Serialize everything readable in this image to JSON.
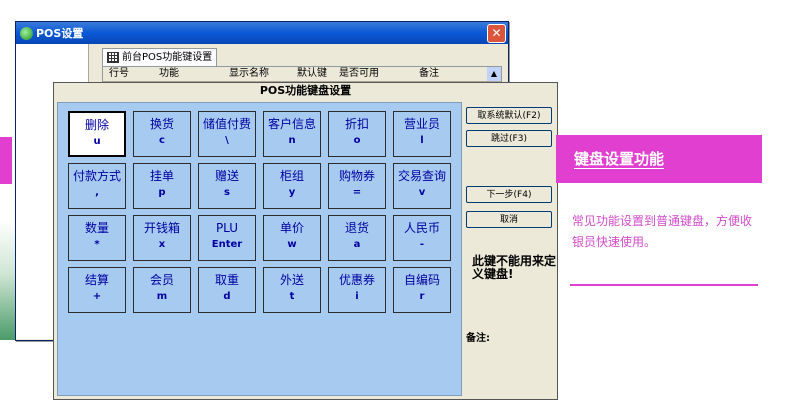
{
  "bg_window": {
    "title": "POS设置",
    "tab_label": "前台POS功能键设置",
    "column_headers": [
      "行号",
      "功能",
      "显示名称",
      "默认键",
      "是否可用",
      "备注"
    ]
  },
  "dialog": {
    "title": "POS功能键盘设置",
    "keys": [
      {
        "name": "删除",
        "code": "u"
      },
      {
        "name": "换货",
        "code": "c"
      },
      {
        "name": "储值付费",
        "code": "\\"
      },
      {
        "name": "客户信息",
        "code": "n"
      },
      {
        "name": "折扣",
        "code": "o"
      },
      {
        "name": "营业员",
        "code": "l"
      },
      {
        "name": "付款方式",
        "code": ","
      },
      {
        "name": "挂单",
        "code": "p"
      },
      {
        "name": "赠送",
        "code": "s"
      },
      {
        "name": "柜组",
        "code": "y"
      },
      {
        "name": "购物券",
        "code": "="
      },
      {
        "name": "交易查询",
        "code": "v"
      },
      {
        "name": "数量",
        "code": "*"
      },
      {
        "name": "开钱箱",
        "code": "x"
      },
      {
        "name": "PLU",
        "code": "Enter"
      },
      {
        "name": "单价",
        "code": "w"
      },
      {
        "name": "退货",
        "code": "a"
      },
      {
        "name": "人民币",
        "code": "-"
      },
      {
        "name": "结算",
        "code": "+"
      },
      {
        "name": "会员",
        "code": "m"
      },
      {
        "name": "取重",
        "code": "d"
      },
      {
        "name": "外送",
        "code": "t"
      },
      {
        "name": "优惠券",
        "code": "i"
      },
      {
        "name": "自编码",
        "code": "r"
      }
    ],
    "buttons": {
      "default": "取系统默认(F2)",
      "skip": "跳过(F3)",
      "next": "下一步(F4)",
      "cancel": "取消"
    },
    "warning": "此键不能用来定义键盘!",
    "note_label": "备注:"
  },
  "promo": {
    "title": "键盘设置功能",
    "description": "常见功能设置到普通键盘，方便收银员快速使用。"
  },
  "colors": {
    "accent": "#e13fcf",
    "key_area": "#a6caf0",
    "xp_title": "#0a58d6"
  }
}
